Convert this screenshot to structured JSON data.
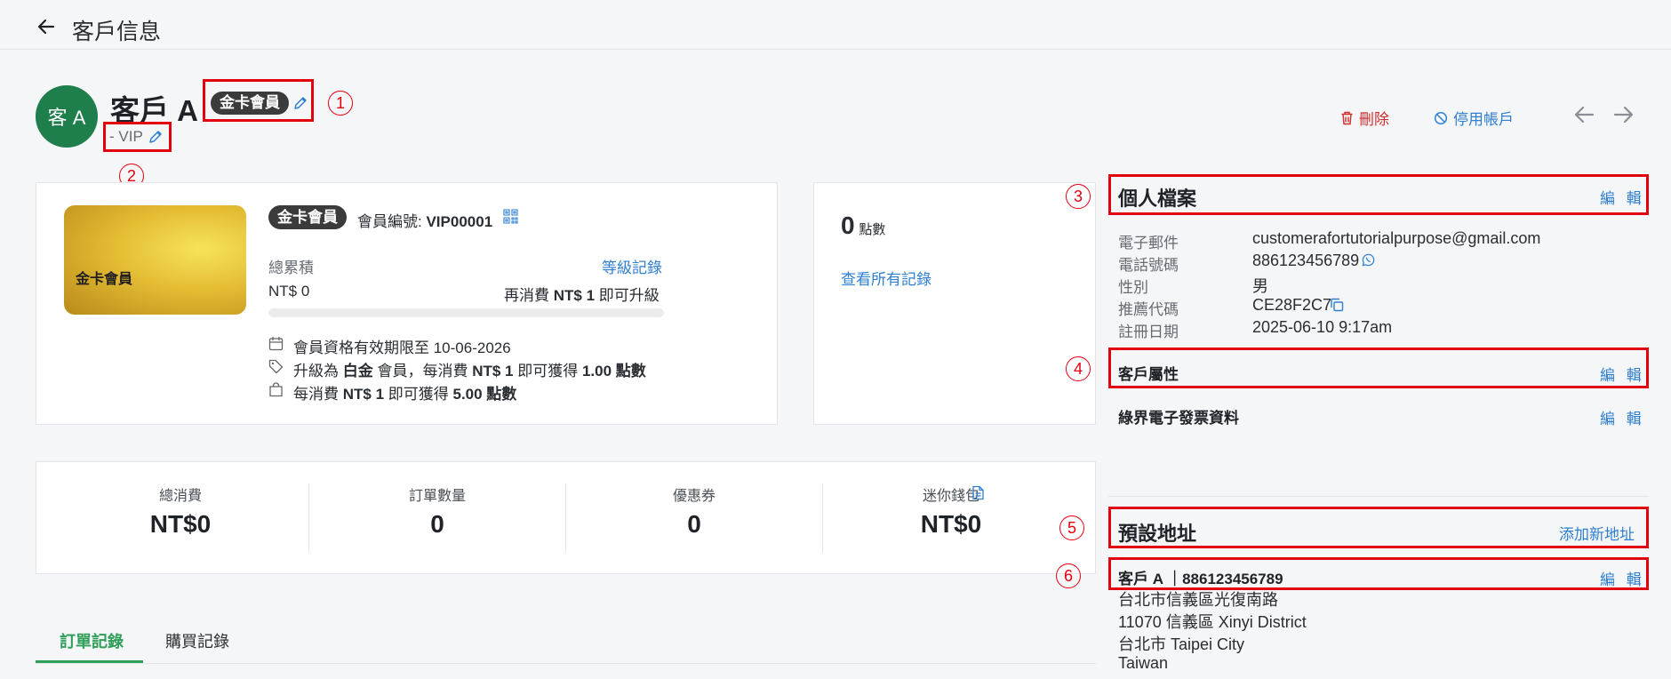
{
  "header": {
    "title": "客戶信息"
  },
  "customer": {
    "avatar_text": "客 A",
    "name": "客戶 A",
    "tier": "金卡會員",
    "tag": "- VIP"
  },
  "actions": {
    "delete": "刪除",
    "disable": "停用帳戶"
  },
  "annotations": [
    "1",
    "2",
    "3",
    "4",
    "5",
    "6"
  ],
  "membership": {
    "card_label": "金卡會員",
    "tier": "金卡會員",
    "member_no_label": "會員編號:",
    "member_no": "VIP00001",
    "total_label": "總累積",
    "level_history": "等級記錄",
    "total_value": "NT$ 0",
    "upgrade_prefix": "再消費",
    "upgrade_amount": "NT$ 1",
    "upgrade_suffix": "即可升級",
    "progress_percent": 0,
    "validity": "會員資格有效期限至 10-06-2026",
    "upgrade_prefix2": "升級為",
    "upgrade_tier": "白金",
    "upgrade_mid": "會員，每消費",
    "upgrade_spend": "NT$ 1",
    "upgrade_mid2": "即可獲得",
    "upgrade_points": "1.00 點數",
    "earn_prefix": "每消費",
    "earn_spend": "NT$ 1",
    "earn_mid": "即可獲得",
    "earn_points": "5.00 點數"
  },
  "points": {
    "value": "0",
    "unit": "點數",
    "view_all": "查看所有記錄"
  },
  "stats": [
    {
      "label": "總消費",
      "value": "NT$0"
    },
    {
      "label": "訂單數量",
      "value": "0"
    },
    {
      "label": "優惠券",
      "value": "0"
    },
    {
      "label": "迷你錢包",
      "value": "NT$0"
    }
  ],
  "profile": {
    "title": "個人檔案",
    "edit": "編 輯",
    "fields": [
      {
        "label": "電子郵件",
        "value": "customerafortutorialpurpose@gmail.com"
      },
      {
        "label": "電話號碼",
        "value": "886123456789"
      },
      {
        "label": "性別",
        "value": "男"
      },
      {
        "label": "推薦代碼",
        "value": "CE28F2C7"
      },
      {
        "label": "註冊日期",
        "value": "2025-06-10 9:17am"
      }
    ]
  },
  "attributes": {
    "title": "客戶屬性",
    "edit": "編 輯"
  },
  "einvoice": {
    "title": "綠界電子發票資料",
    "edit": "編 輯"
  },
  "address": {
    "title": "預設地址",
    "add": "添加新地址",
    "contact": "客戶 A ｜886123456789",
    "edit": "編 輯",
    "lines": [
      "台北市信義區光復南路",
      "11070 信義區 Xinyi District",
      "台北市 Taipei City",
      "Taiwan"
    ]
  },
  "tabs": [
    {
      "label": "訂單記錄"
    },
    {
      "label": "購買記錄"
    }
  ],
  "colors": {
    "accent": "#2f7fd1",
    "green": "#2e9e58",
    "danger": "#d12d2d",
    "annotation": "#e3000f"
  }
}
